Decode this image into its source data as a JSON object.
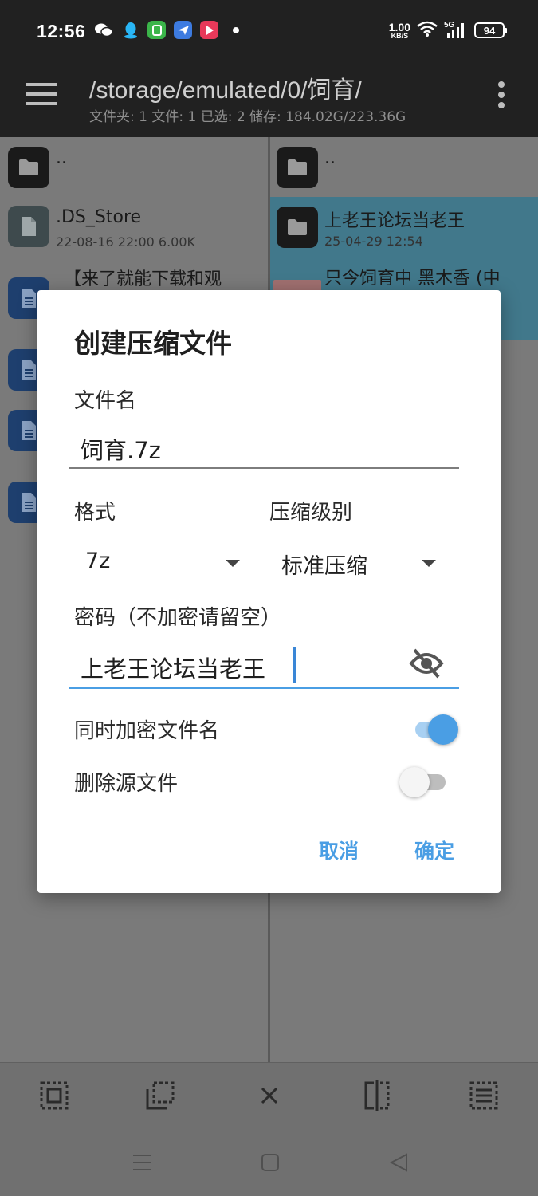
{
  "status": {
    "time": "12:56",
    "net_speed_value": "1.00",
    "net_speed_unit": "KB/S",
    "signal_label": "5G",
    "battery": "94"
  },
  "appbar": {
    "path": "/storage/emulated/0/饲育/",
    "info": "文件夹: 1  文件: 1  已选: 2  储存: 184.02G/223.36G"
  },
  "left_pane": {
    "parent": "..",
    "items": [
      {
        "name": ".DS_Store",
        "meta": "22-08-16 22:00  6.00K"
      },
      {
        "name": "【来了就能下载和观"
      }
    ]
  },
  "right_pane": {
    "parent": "..",
    "items": [
      {
        "name": "上老王论坛当老王",
        "meta": "25-04-29 12:54"
      },
      {
        "name": "只今饲育中  黑木香 (中"
      }
    ]
  },
  "dialog": {
    "title": "创建压缩文件",
    "filename_label": "文件名",
    "filename_value": "饲育.7z",
    "format_label": "格式",
    "format_value": "7z",
    "level_label": "压缩级别",
    "level_value": "标准压缩",
    "password_label": "密码（不加密请留空）",
    "password_value": "上老王论坛当老王",
    "encrypt_names_label": "同时加密文件名",
    "encrypt_names_on": true,
    "delete_source_label": "删除源文件",
    "delete_source_on": false,
    "cancel_label": "取消",
    "confirm_label": "确定"
  },
  "colors": {
    "accent": "#4a9ee4",
    "appbar": "#212121",
    "selected_row": "#41788b"
  }
}
